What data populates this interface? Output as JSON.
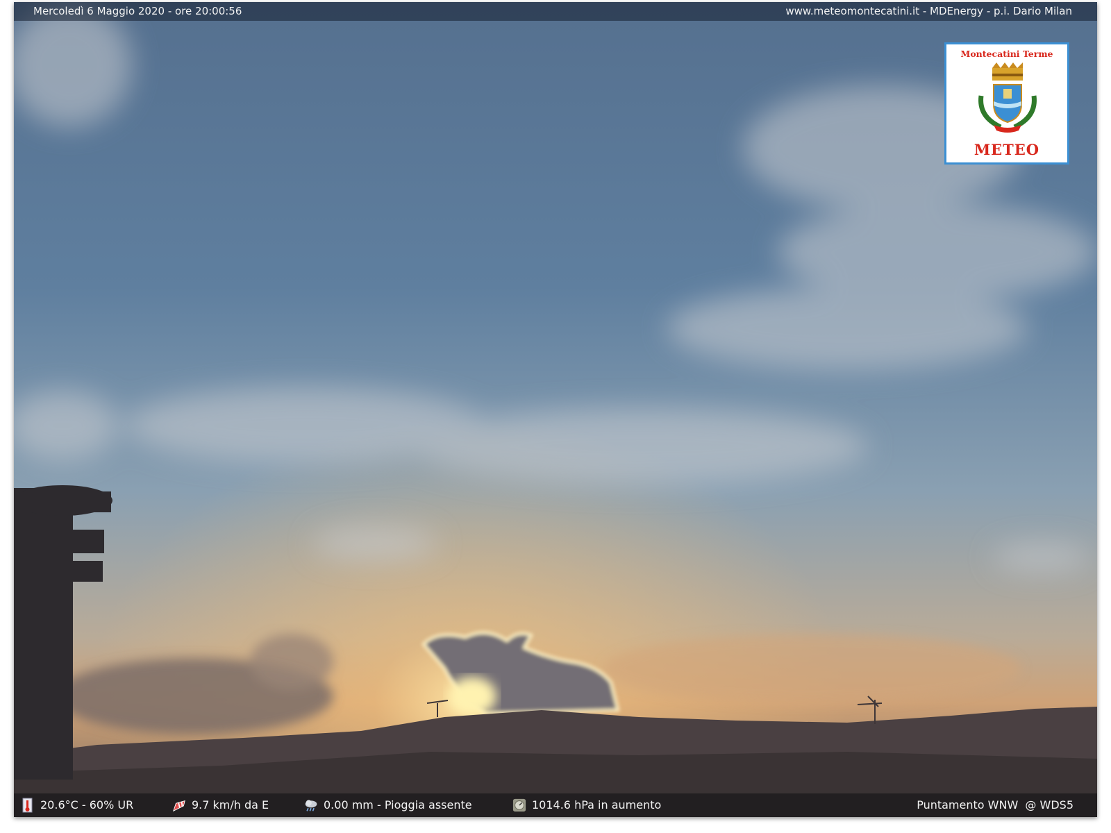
{
  "overlay_top": {
    "datetime": "Mercoledì 6 Maggio 2020 - ore 20:00:56",
    "credits": "www.meteomontecatini.it - MDEnergy - p.i. Dario Milan"
  },
  "logo": {
    "title": "Montecatini Terme",
    "subtitle": "METEO"
  },
  "overlay_bottom": {
    "temperature_humidity": "20.6°C - 60% UR",
    "wind": "9.7 km/h da E",
    "rain": "0.00 mm - Pioggia assente",
    "pressure": "1014.6 hPa in aumento",
    "pointing": "Puntamento WNW  @ WDS5"
  },
  "icons": {
    "temperature": "thermometer-icon",
    "wind": "windsock-icon",
    "rain": "rain-cloud-icon",
    "pressure": "barometer-icon"
  },
  "colors": {
    "sky_top": "#5a7593",
    "sky_horizon": "#d9a56f",
    "sun": "#fff2b0",
    "logo_red": "#d8271c",
    "logo_border": "#3b8fd3"
  }
}
